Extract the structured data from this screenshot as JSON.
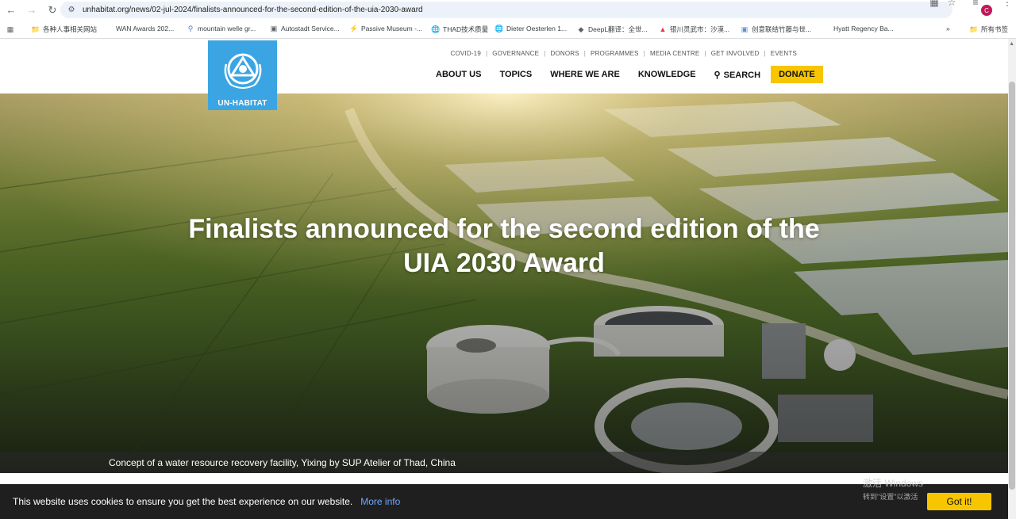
{
  "browser": {
    "url": "unhabitat.org/news/02-jul-2024/finalists-announced-for-the-second-edition-of-the-uia-2030-award",
    "profile_initial": "C",
    "bookmarks": [
      "各种人事相关网站",
      "WAN Awards 202...",
      "mountain welle gr...",
      "Autostadt Service...",
      "Passive Museum -...",
      "THAD技术质量",
      "Dieter Oesterlen 1...",
      "DeepL翻译：全世...",
      "银川灵武市：沙漠...",
      "创意联结竹藤与世...",
      "Hyatt Regency Ba..."
    ],
    "bookmarks_more": "»",
    "all_bookmarks": "所有书签"
  },
  "site": {
    "logo_text": "UN-HABITAT",
    "util_nav": [
      "COVID-19",
      "GOVERNANCE",
      "DONORS",
      "PROGRAMMES",
      "MEDIA CENTRE",
      "GET INVOLVED",
      "EVENTS"
    ],
    "main_nav": [
      "ABOUT US",
      "TOPICS",
      "WHERE WE ARE",
      "KNOWLEDGE"
    ],
    "search_label": "SEARCH",
    "donate_label": "DONATE"
  },
  "hero": {
    "title_line1": "Finalists announced for the second edition of the",
    "title_line2": "UIA 2030 Award",
    "caption": "Concept of a water resource recovery facility, Yixing by SUP Atelier of Thad, China"
  },
  "cookie": {
    "message": "This website uses cookies to ensure you get the best experience on our website.",
    "link": "More info",
    "button": "Got it!"
  },
  "watermark": {
    "line1": "激活 Windows",
    "line2": "转到\"设置\"以激活"
  }
}
